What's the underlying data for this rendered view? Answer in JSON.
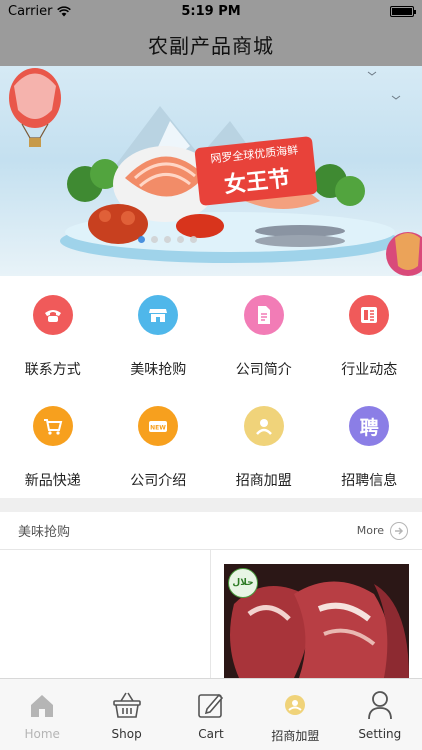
{
  "status_bar": {
    "carrier": "Carrier",
    "time": "5:19 PM",
    "battery_level": 1.0
  },
  "nav": {
    "title": "农副产品商城"
  },
  "banner": {
    "tag_line1": "网罗全球优质海鲜",
    "tag_line2": "女王节",
    "dot_count": 5,
    "active_dot": 0
  },
  "grid": {
    "items": [
      {
        "label": "联系方式",
        "icon": "phone-icon",
        "color": "#f05a5a"
      },
      {
        "label": "美味抢购",
        "icon": "shop-icon",
        "color": "#4fb7ea"
      },
      {
        "label": "公司简介",
        "icon": "document-icon",
        "color": "#f27cb6"
      },
      {
        "label": "行业动态",
        "icon": "newspaper-icon",
        "color": "#f05a5a"
      },
      {
        "label": "新品快递",
        "icon": "cart-icon",
        "color": "#f7a01e"
      },
      {
        "label": "公司介绍",
        "icon": "new-tag-icon",
        "color": "#f7a01e"
      },
      {
        "label": "招商加盟",
        "icon": "handshake-icon",
        "color": "#f0d37a"
      },
      {
        "label": "招聘信息",
        "icon": "recruit-icon",
        "color": "#8b7ee6",
        "glyph": "聘"
      }
    ]
  },
  "section": {
    "title": "美味抢购",
    "more_label": "More"
  },
  "product": {
    "badge_text": "حلال"
  },
  "tabs": [
    {
      "label": "Home",
      "icon": "home-icon"
    },
    {
      "label": "Shop",
      "icon": "basket-icon"
    },
    {
      "label": "Cart",
      "icon": "edit-icon"
    },
    {
      "label": "招商加盟",
      "icon": "handshake-icon"
    },
    {
      "label": "Setting",
      "icon": "person-icon"
    }
  ],
  "colors": {
    "bar_gray": "#9b9b9b",
    "active_dot": "#2f7fd8",
    "tab_inactive_label": "#b5b5b5"
  }
}
